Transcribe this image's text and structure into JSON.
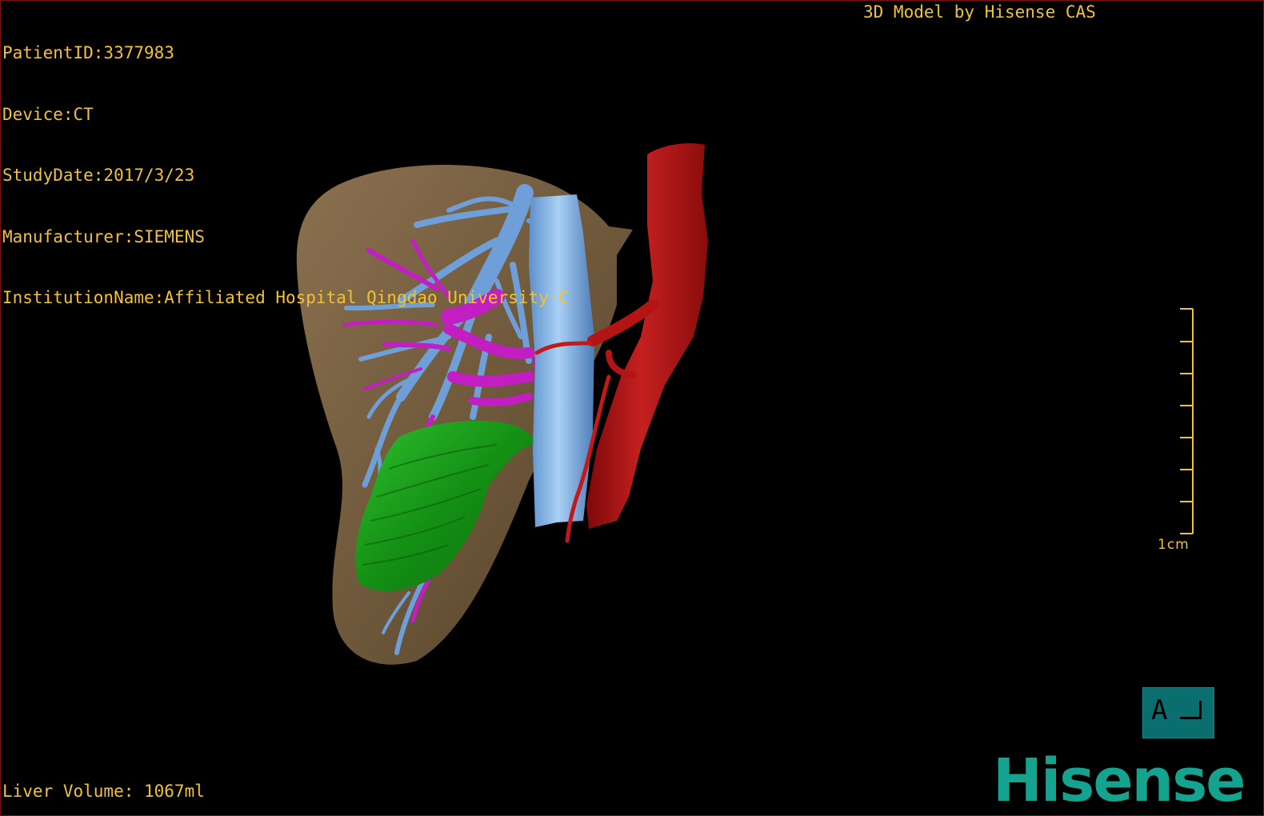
{
  "header": {
    "patient_id": "PatientID:3377983",
    "device": "Device:CT",
    "study_date": "StudyDate:2017/3/23",
    "manufacturer": "Manufacturer:SIEMENS",
    "institution": "InstitutionName:Affiliated Hospital Qingdao University-C"
  },
  "brand_caption": "3D Model by Hisense CAS",
  "footer": {
    "liver_volume": "Liver Volume: 1067ml"
  },
  "scale_bar": {
    "label": "1cm"
  },
  "orientation_button": {
    "label": "A"
  },
  "logo": {
    "text": "Hisense"
  },
  "colors": {
    "overlay_text": "#f2c230",
    "liver": "#7a6347",
    "portal_vein": "#6f9fd8",
    "hepatic_vein": "#c21ec2",
    "ivc": "#7fb3e8",
    "aorta": "#b41414",
    "gallbladder": "#1c9c1c",
    "brand": "#14a38f"
  }
}
